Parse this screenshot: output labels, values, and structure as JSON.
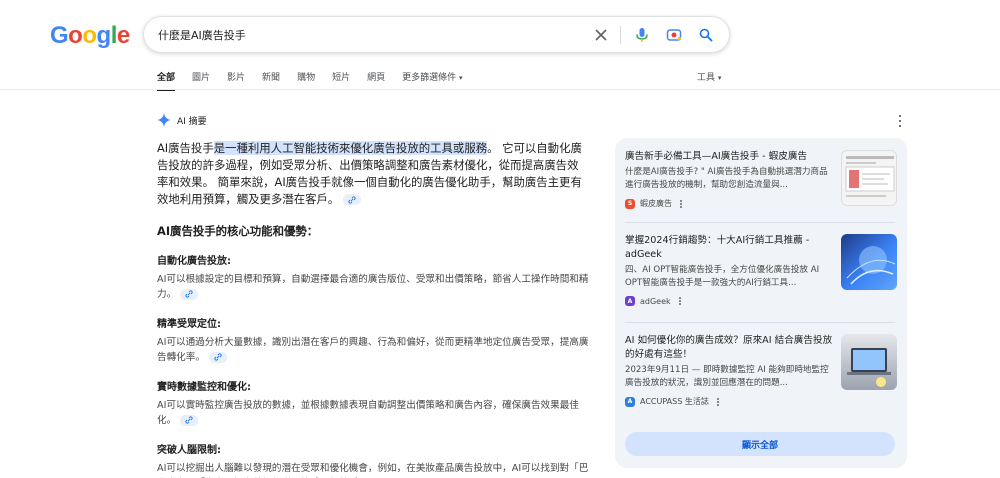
{
  "search": {
    "query": "什麼是AI廣告投手"
  },
  "tabs": [
    {
      "label": "全部"
    },
    {
      "label": "圖片"
    },
    {
      "label": "影片"
    },
    {
      "label": "新聞"
    },
    {
      "label": "購物"
    },
    {
      "label": "短片"
    },
    {
      "label": "網頁"
    },
    {
      "label": "更多篩選條件"
    }
  ],
  "tools_label": "工具",
  "ai_overview": {
    "heading": "AI 摘要",
    "lead_plain": "AI廣告投手",
    "lead_highlight": "是一種利用人工智能技術來優化廣告投放的工具或服務",
    "lead_rest": "。 它可以自動化廣告投放的許多過程，例如受眾分析、出價策略調整和廣告素材優化，從而提高廣告效率和效果。 簡單來說，AI廣告投手就像一個自動化的廣告優化助手，幫助廣告主更有效地利用預算，觸及更多潛在客戶。",
    "section_title": "AI廣告投手的核心功能和優勢：",
    "items": [
      {
        "title": "自動化廣告投放:",
        "body": "AI可以根據設定的目標和預算，自動選擇最合適的廣告版位、受眾和出價策略，節省人工操作時間和精力。"
      },
      {
        "title": "精準受眾定位:",
        "body": "AI可以通過分析大量數據，識別出潛在客戶的興趣、行為和偏好，從而更精準地定位廣告受眾，提高廣告轉化率。"
      },
      {
        "title": "實時數據監控和優化:",
        "body": "AI可以實時監控廣告投放的數據，並根據數據表現自動調整出價策略和廣告內容，確保廣告效果最佳化。"
      },
      {
        "title": "突破人腦限制:",
        "body": "AI可以挖掘出人腦難以發現的潛在受眾和優化機會，例如，在美妝產品廣告投放中，AI可以找到對「巴黎世家」、「半島電視台英語頻道」等感興趣的受眾。"
      }
    ]
  },
  "sources": [
    {
      "title": "廣告新手必備工具—AI廣告投手 - 蝦皮廣告",
      "snippet": "什麼是AI廣告投手? \" AI廣告投手為自動挑選潛力商品進行廣告投放的機制，幫助您創造流量與...",
      "site": "蝦皮廣告",
      "favicon_color": "#ee4d2d"
    },
    {
      "title": "掌握2024行銷趨勢：十大AI行銷工具推薦 - adGeek",
      "snippet": "四、AI OPT智能廣告投手，全方位優化廣告投放 AI OPT智能廣告投手是一款強大的AI行銷工具...",
      "site": "adGeek",
      "favicon_color": "#6b3fd4"
    },
    {
      "title": "AI 如何優化你的廣告成效？原來AI 結合廣告投放的好處有這些！",
      "snippet": "2023年9月11日 — 即時數據監控 AI 能夠即時地監控廣告投放的狀況，識別並回應潛在的問題...",
      "site": "ACCUPASS 生活誌",
      "favicon_color": "#2e7de0"
    }
  ],
  "show_all_label": "顯示全部",
  "colors": {
    "accent": "#0b57d0",
    "highlight": "#d3e3fd",
    "panel_bg": "#f0f4f9"
  }
}
